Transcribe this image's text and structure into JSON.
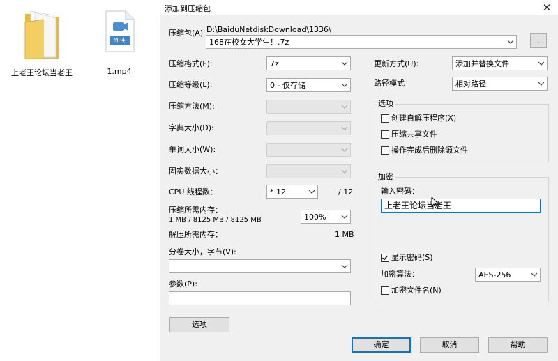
{
  "desktop": {
    "folder": {
      "label": "上老王论坛当老王",
      "icon": "folder-icon"
    },
    "video": {
      "label": "1.mp4",
      "badge": "MP4",
      "icon": "video-file-icon"
    }
  },
  "dialog": {
    "title": "添加到压缩包",
    "archive_label": "压缩包(A)",
    "archive_path": "D:\\BaiduNetdiskDownload\\1336\\",
    "archive_name": "168在校女大学生！.7z",
    "browse_label": "...",
    "left": {
      "format_label": "压缩格式(F):",
      "format_value": "7z",
      "level_label": "压缩等级(L):",
      "level_value": "0 - 仅存储",
      "method_label": "压缩方法(M):",
      "dict_label": "字典大小(D):",
      "word_label": "单词大小(W):",
      "solid_label": "固实数据大小：",
      "threads_label": "CPU 线程数：",
      "threads_value": "* 12",
      "threads_total": "/ 12",
      "mem_comp_label": "压缩所需内存：",
      "mem_comp_value": "1 MB / 8125 MB / 8125 MB",
      "mem_percent": "100%",
      "mem_decomp_label": "解压所需内存：",
      "mem_decomp_value": "1 MB",
      "split_label": "分卷大小，字节(V):",
      "params_label": "参数(P):",
      "options_button": "选项"
    },
    "right": {
      "update_label": "更新方式(U):",
      "update_value": "添加并替换文件",
      "path_label": "路径模式",
      "path_value": "相对路径",
      "options_group": "选项",
      "opt_sfx": "创建自解压程序(X)",
      "opt_shared": "压缩共享文件",
      "opt_delete": "操作完成后删除源文件",
      "encrypt_group": "加密",
      "password_label": "输入密码：",
      "password_value": "上老王论坛当老王",
      "show_password": "显示密码(S)",
      "algo_label": "加密算法：",
      "algo_value": "AES-256",
      "encrypt_names": "加密文件名(N)"
    },
    "buttons": {
      "ok": "确定",
      "cancel": "取消",
      "help": "帮助"
    }
  }
}
